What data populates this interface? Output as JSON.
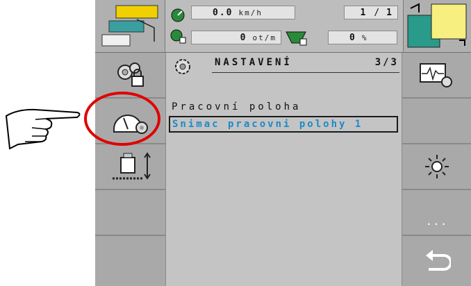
{
  "status": {
    "speed_value": "0.0",
    "speed_unit": "km/h",
    "rpm_value": "0",
    "rpm_unit": "ot/m",
    "counter_a": "1",
    "counter_sep": "/",
    "counter_b": "1",
    "percent_value": "0",
    "percent_unit": "%"
  },
  "menu": {
    "title": "NASTAVENÍ",
    "page": "3/3",
    "items": [
      {
        "label": "Pracovní poloha"
      },
      {
        "label": "Snimac pracovni polohy 1",
        "selected": true
      }
    ]
  },
  "side": {
    "right_more_label": "...",
    "left_icons": [
      "settings-lock-icon",
      "gauge-settings-icon",
      "implement-height-icon"
    ],
    "right_icons": [
      "diagnostics-icon",
      "brightness-icon",
      "more-icon",
      "back-icon"
    ]
  },
  "colors": {
    "highlight": "#e00000",
    "selected_text": "#1b8ac8",
    "panel": "#c4c4c4"
  }
}
